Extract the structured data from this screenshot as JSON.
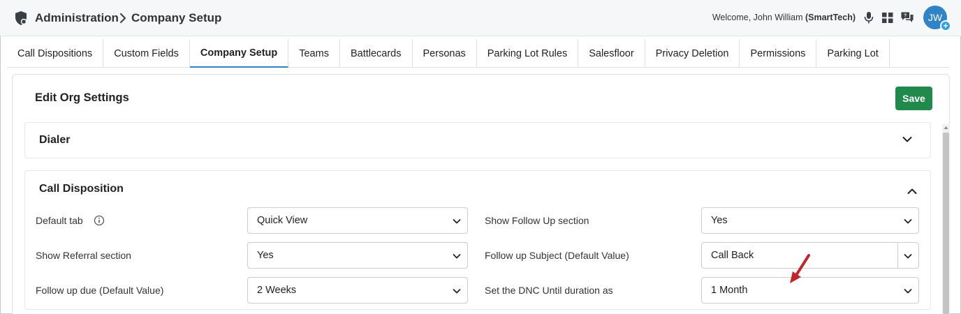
{
  "header": {
    "breadcrumb": [
      "Administration",
      "Company Setup"
    ],
    "welcome_prefix": "Welcome, John William",
    "welcome_org": "(SmartTech)",
    "avatar_initials": "JW",
    "avatar_badge": "+",
    "icons": [
      "shield-icon",
      "chevron-right-icon",
      "microphone-icon",
      "grid-icon",
      "chat-icon"
    ]
  },
  "tabs": [
    {
      "label": "Call Dispositions",
      "active": false
    },
    {
      "label": "Custom Fields",
      "active": false
    },
    {
      "label": "Company Setup",
      "active": true
    },
    {
      "label": "Teams",
      "active": false
    },
    {
      "label": "Battlecards",
      "active": false
    },
    {
      "label": "Personas",
      "active": false
    },
    {
      "label": "Parking Lot Rules",
      "active": false
    },
    {
      "label": "Salesfloor",
      "active": false
    },
    {
      "label": "Privacy Deletion",
      "active": false
    },
    {
      "label": "Permissions",
      "active": false
    },
    {
      "label": "Parking Lot",
      "active": false
    }
  ],
  "card": {
    "title": "Edit Org Settings",
    "save_label": "Save"
  },
  "sections": {
    "dialer": {
      "title": "Dialer",
      "expanded": false
    },
    "call_disposition": {
      "title": "Call Disposition",
      "expanded": true,
      "fields": {
        "default_tab": {
          "label": "Default tab",
          "value": "Quick View"
        },
        "show_follow_up": {
          "label": "Show Follow Up section",
          "value": "Yes"
        },
        "show_referral": {
          "label": "Show Referral section",
          "value": "Yes"
        },
        "follow_up_subject": {
          "label": "Follow up Subject (Default Value)",
          "value": "Call Back"
        },
        "follow_up_due": {
          "label": "Follow up due (Default Value)",
          "value": "2 Weeks"
        },
        "dnc_until": {
          "label": "Set the DNC Until duration as",
          "value": "1 Month"
        }
      }
    }
  },
  "colors": {
    "primary": "#2f83c6",
    "save_green": "#1f8a4c",
    "annotation_arrow": "#c0272d"
  }
}
